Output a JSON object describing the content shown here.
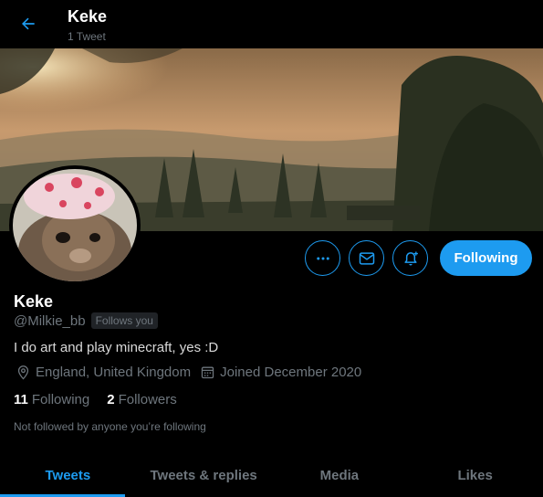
{
  "header": {
    "back_icon": "arrow-left-icon",
    "title": "Keke",
    "subtitle": "1 Tweet"
  },
  "colors": {
    "accent": "#1d9bf0",
    "background": "#000000",
    "secondary_text": "#6e767d"
  },
  "profile": {
    "name": "Keke",
    "handle": "@Milkie_bb",
    "follows_you_label": "Follows you",
    "bio": "I do art and play minecraft, yes :D",
    "location": "England, United Kingdom",
    "joined": "Joined December 2020",
    "following_count": "11",
    "following_label": "Following",
    "followers_count": "2",
    "followers_label": "Followers",
    "not_followed_note": "Not followed by anyone you’re following"
  },
  "actions": {
    "more_icon": "more-icon",
    "message_icon": "mail-icon",
    "notify_icon": "bell-plus-icon",
    "follow_label": "Following"
  },
  "tabs": [
    {
      "label": "Tweets",
      "active": true
    },
    {
      "label": "Tweets & replies",
      "active": false
    },
    {
      "label": "Media",
      "active": false
    },
    {
      "label": "Likes",
      "active": false
    }
  ]
}
